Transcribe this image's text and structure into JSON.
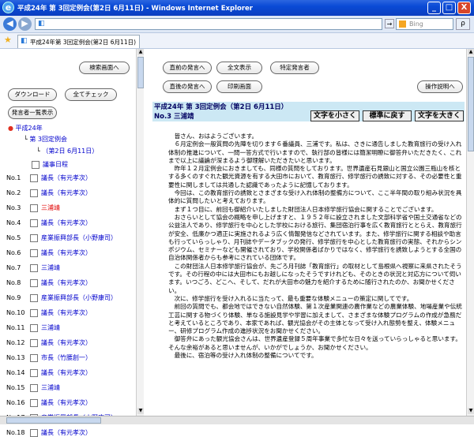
{
  "window": {
    "title": "平成24年 第 3回定例会(第2日 6月11日) - Windows Internet Explorer",
    "minimize": "_",
    "maximize": "□",
    "close": "X"
  },
  "address_bar": {
    "search_placeholder": "Bing",
    "search_button": "ρ"
  },
  "favorites": {
    "tab_title": "平成24年第 3回定例会(第2日 6月11日)"
  },
  "sidebar": {
    "search_button": "検索画面へ",
    "download_button": "ダウンロード",
    "check_all_button": "全てチェック",
    "show_speakers_button": "発言者一覧表示",
    "tree": {
      "year": "平成24年",
      "session": "第 3回定例会",
      "day": "（第2日 6月11日）",
      "agenda": "議事日程"
    },
    "items": [
      {
        "no": "No.1",
        "label": "議長（有元孝次）",
        "red": false
      },
      {
        "no": "No.2",
        "label": "議長（有元孝次）",
        "red": false
      },
      {
        "no": "No.3",
        "label": "三浦靖",
        "red": true
      },
      {
        "no": "No.4",
        "label": "議長（有元孝次）",
        "red": false
      },
      {
        "no": "No.5",
        "label": "産業振興部長（小野康司）",
        "red": false
      },
      {
        "no": "No.6",
        "label": "議長（有元孝次）",
        "red": false
      },
      {
        "no": "No.7",
        "label": "三浦靖",
        "red": false
      },
      {
        "no": "No.8",
        "label": "議長（有元孝次）",
        "red": false
      },
      {
        "no": "No.9",
        "label": "産業振興部長（小野康司）",
        "red": false
      },
      {
        "no": "No.10",
        "label": "議長（有元孝次）",
        "red": false
      },
      {
        "no": "No.11",
        "label": "三浦靖",
        "red": false
      },
      {
        "no": "No.12",
        "label": "議長（有元孝次）",
        "red": false
      },
      {
        "no": "No.13",
        "label": "市長（竹腰創一）",
        "red": false
      },
      {
        "no": "No.14",
        "label": "議長（有元孝次）",
        "red": false
      },
      {
        "no": "No.15",
        "label": "三浦靖",
        "red": false
      },
      {
        "no": "No.16",
        "label": "議長（有元孝次）",
        "red": false
      },
      {
        "no": "No.17",
        "label": "産業振興部長（小野康司）",
        "red": false
      },
      {
        "no": "No.18",
        "label": "議長（有元孝次）",
        "red": false
      }
    ]
  },
  "toolbar": {
    "prev_speech": "直前の発言へ",
    "full_text": "全文表示",
    "specific_speaker": "特定発言者",
    "next_speech": "直後の発言へ",
    "print_screen": "印刷画面",
    "help": "操作説明へ"
  },
  "main": {
    "session_title": "平成24年 第 3回定例会（第2日 6月11日）",
    "speaker": "No.3 三浦靖",
    "text_smaller": "文字を小さく",
    "text_standard": "標準に戻す",
    "text_larger": "文字を大きく",
    "paragraphs": [
      "皆さん、おはようございます。",
      "６月定例会一般質問の先陣を切ります６番議員、三浦です。私は、さきに通告しました教育旅行の受け入れ体制の推進について、一問一答方式で行いますので、執行部の皆様には簡潔明瞭に御答弁いただきたく、これまで以上に議論が深まるよう御理解いただきたいと思います。",
      "昨年１２月定例会におきましても、同様の質問をしております。世界遺産石見銀山と国立公園三瓶山を核とする多くのすぐれた観光資源を有する大田市において、教育旅行、修学旅行の誘致に対する、その必要性と重要性に関しましては共通した認識であったように記憶しております。",
      "今回は、この教育旅行の誘致とさまざまな受け入れ体制の整備方について、ここ半年間の取り組み状況を具体的に質問したいと考えております。",
      "まず１つ目に、前回も御紹介いたしました財団法人日本修学旅行協会に関することでございます。",
      "おさらいとして協会の概略を申し上げますと、１９５２年に設立されました文部科学省や国土交通省などの公益法人であり、修学旅行を中心とした学校における旅行、集団宿泊行事を広く教育旅行ととらえ、教育旅行が安全、低廉かつ適正に実施されるよう広く情報発信などされています。また、修学旅行に関する相談や助言も行っていらっしゃり、月刊誌やデータブックの発行、修学旅行を中心とした教育旅行の実態、それからシンポジウム、セミナーなども開催されており、学校関係者ばかりではなく、修学旅行を誘致しようとする全国の自治体関係者からも参考にされている団体です。",
      "この財団法人日本修学旅行協会が、先ごろ月刊誌「教育旅行」の取材として島根県へ視察に来県されたそうです。その行程の中には大田市にもお越しになったそうですけれども、そのときの状況と対応方について伺います。いつごろ、どこへ、そして、だれが大田市の魅力を紹介するために随行されたのか、お聞かせください。",
      "次に、修学旅行を受け入れるに当たって、最も重要な体験メニューの策定に関してです。",
      "前回の質問でも、都会地ではできない自然体験、第１次産業関連の農作業などの農業体験、地場産業や伝統工芸に関する物づくり体験、単なる施設見学や学習に加えまして、さまざまな体験プログラムの作成が急務だと考えているところであり、本家であれば、観光協会がその主体となって受け入れ態勢を整え、体験メニュー、研修プログラム作成の進捗状況をお聞かせください。",
      "御答弁にあった観光協会さんは、世界遺産登録５周年事業で多忙な日々を送っていらっしゃると思います。そんな余裕があると思いませんが、いかがでしょうか、お聞かせください。",
      "最後に、宿泊等の受け入れ体制の整備についてです。"
    ]
  }
}
